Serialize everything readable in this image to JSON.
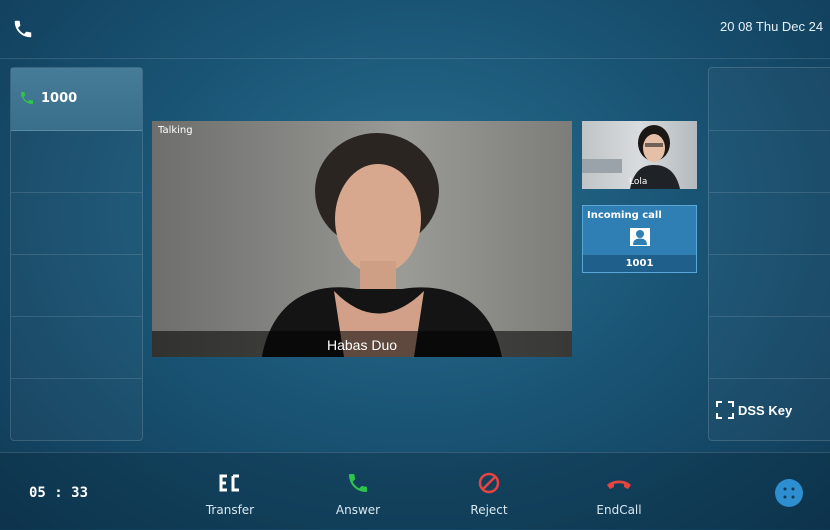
{
  "status_bar": {
    "datetime": "20 08 Thu Dec 24"
  },
  "line_keys": {
    "line_1": "1000"
  },
  "main_video": {
    "status": "Talking",
    "caller_name": "Habas Duo"
  },
  "pip_video": {
    "name": "Lola"
  },
  "incoming_call": {
    "title": "Incoming call",
    "number": "1001"
  },
  "dss_key": {
    "label": "DSS Key"
  },
  "bottom_bar": {
    "call_duration": "05 : 33",
    "softkeys": {
      "transfer": "Transfer",
      "answer": "Answer",
      "reject": "Reject",
      "endcall": "EndCall"
    }
  },
  "colors": {
    "answer_green": "#2ec44b",
    "reject_red": "#e8443f",
    "accent_blue": "#2d8ed0"
  }
}
